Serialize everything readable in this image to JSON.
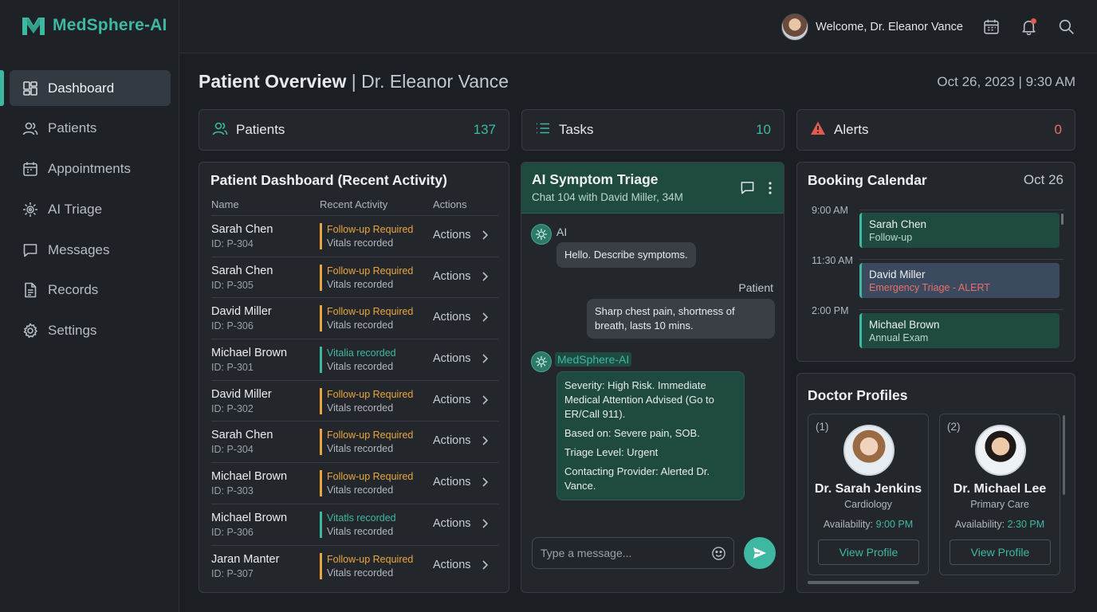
{
  "app": {
    "name": "MedSphere-AI"
  },
  "sidebar": {
    "items": [
      {
        "label": "Dashboard",
        "icon": "dashboard-icon",
        "active": true
      },
      {
        "label": "Patients",
        "icon": "users-icon"
      },
      {
        "label": "Appointments",
        "icon": "calendar-icon"
      },
      {
        "label": "AI Triage",
        "icon": "ai-icon"
      },
      {
        "label": "Messages",
        "icon": "message-icon"
      },
      {
        "label": "Records",
        "icon": "document-icon"
      },
      {
        "label": "Settings",
        "icon": "gear-icon"
      }
    ]
  },
  "topbar": {
    "welcome": "Welcome, Dr. Eleanor Vance"
  },
  "header": {
    "title": "Patient Overview",
    "separator": " | ",
    "doctor": "Dr. Eleanor Vance",
    "datetime": "Oct 26, 2023 | 9:30 AM"
  },
  "stats": {
    "patients": {
      "label": "Patients",
      "value": "137"
    },
    "tasks": {
      "label": "Tasks",
      "value": "10"
    },
    "alerts": {
      "label": "Alerts",
      "value": "0"
    }
  },
  "patient_dashboard": {
    "title": "Patient Dashboard (Recent Activity)",
    "columns": [
      "Name",
      "Recent Activity",
      "Actions"
    ],
    "action_label": "Actions",
    "rows": [
      {
        "name": "Sarah Chen",
        "id": "ID: P-304",
        "activity": "Follow-up Required",
        "detail": "Vitals recorded",
        "status": "warning"
      },
      {
        "name": "Sarah Chen",
        "id": "ID: P-305",
        "activity": "Follow-up Required",
        "detail": "Vitals recorded",
        "status": "warning"
      },
      {
        "name": "David Miller",
        "id": "ID: P-306",
        "activity": "Follow-up Required",
        "detail": "Vitals recorded",
        "status": "warning"
      },
      {
        "name": "Michael Brown",
        "id": "ID: P-301",
        "activity": "Vitalia recorded",
        "detail": "Vitals recorded",
        "status": "ok"
      },
      {
        "name": "David Miller",
        "id": "ID: P-302",
        "activity": "Follow-up Required",
        "detail": "Vitals recorded",
        "status": "warning"
      },
      {
        "name": "Sarah Chen",
        "id": "ID: P-304",
        "activity": "Follow-up Required",
        "detail": "Vitals recorded",
        "status": "warning"
      },
      {
        "name": "Michael Brown",
        "id": "ID: P-303",
        "activity": "Follow-up Required",
        "detail": "Vitals recorded",
        "status": "warning"
      },
      {
        "name": "Michael Brown",
        "id": "ID: P-306",
        "activity": "Vitatls recorded",
        "detail": "Vitals recorded",
        "status": "ok"
      },
      {
        "name": "Jaran Manter",
        "id": "ID: P-307",
        "activity": "Follow-up Required",
        "detail": "Vitals recorded",
        "status": "warning"
      }
    ]
  },
  "triage": {
    "title": "AI Symptom Triage",
    "subtitle": "Chat 104 with David Miller, 34M",
    "ai_label": "AI",
    "ai_message": "Hello. Describe symptoms.",
    "patient_label": "Patient",
    "patient_message": "Sharp chest pain, shortness of breath, lasts 10 mins.",
    "assistant_label": "MedSphere-AI",
    "assessment": {
      "severity": "Severity: High Risk. Immediate Medical Attention Advised (Go to ER/Call 911).",
      "based_on": "Based on: Severe pain, SOB.",
      "level": "Triage Level: Urgent",
      "contact": "Contacting Provider: Alerted Dr. Vance."
    },
    "input_placeholder": "Type a message..."
  },
  "booking": {
    "title": "Booking Calendar",
    "date": "Oct 26",
    "slots": [
      {
        "time": "9:00 AM",
        "name": "Sarah Chen",
        "desc": "Follow-up"
      },
      {
        "time": "11:30 AM",
        "name": "David Miller",
        "desc": "Emergency Triage - ALERT"
      },
      {
        "time": "2:00 PM",
        "name": "Michael Brown",
        "desc": "Annual Exam"
      }
    ]
  },
  "doctors": {
    "title": "Doctor Profiles",
    "availability_label": "Availability:",
    "view_label": "View Profile",
    "list": [
      {
        "index": "(1)",
        "name": "Dr. Sarah Jenkins",
        "specialty": "Cardiology",
        "time": "9:00 PM"
      },
      {
        "index": "(2)",
        "name": "Dr. Michael Lee",
        "specialty": "Primary Care",
        "time": "2:30 PM"
      }
    ]
  },
  "colors": {
    "accent": "#3fb8a2",
    "warning": "#e8a640",
    "danger": "#e8706a",
    "background": "#1b1e22",
    "panel": "#23272c"
  }
}
